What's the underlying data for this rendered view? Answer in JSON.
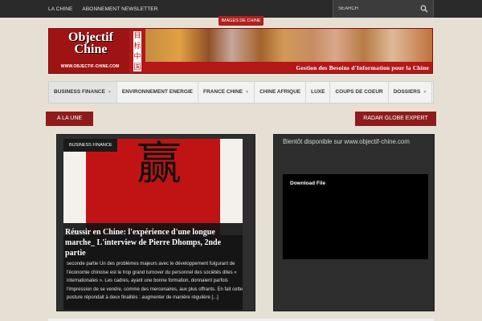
{
  "topbar": {
    "links": [
      "LA CHINE",
      "ABONNEMENT NEWSLETTER"
    ],
    "search_placeholder": "SEARCH"
  },
  "images_tab": "IMAGES DE CHINE",
  "banner": {
    "logo_line1": "Objectif",
    "logo_line2": "Chine",
    "logo_url": "WWW.OBJECTIF-CHINE.COM",
    "cn_chars": [
      "目",
      "标",
      "中",
      "国"
    ],
    "slogan": "Gestion des Besoins d'Information pour la Chine"
  },
  "nav": {
    "items": [
      {
        "label": "BUSINESS FINANCE",
        "has_dropdown": true
      },
      {
        "label": "ENVIRONNEMENT ENERGIE",
        "has_dropdown": false
      },
      {
        "label": "FRANCE CHINE",
        "has_dropdown": true
      },
      {
        "label": "CHINE AFRIQUE",
        "has_dropdown": false
      },
      {
        "label": "LUXE",
        "has_dropdown": false
      },
      {
        "label": "COUPS DE COEUR",
        "has_dropdown": false
      },
      {
        "label": "DOSSIERS",
        "has_dropdown": true
      }
    ]
  },
  "sections": {
    "left": "A LA UNE",
    "right": "RADAR GLOBE EXPERT"
  },
  "feature": {
    "category": "BUSINESS FINANCE",
    "glyph": "赢",
    "title": "Réussir en Chine: l'expérience d'une longue marche_ L'interview de Pierre Dhomps, 2nde partie",
    "excerpt": " seconde partie   Un des problèmes majeurs avec le développement fulgurant de l'économie chinoise est le trop grand turnover du personnel des sociétés dites « internationales ». Les cadres, ayant une bonne formation, donnaient parfois l'impression de se vendre, comme des mercenaires, aux plus offrants. En fait cette posture répondait à deux finalités : augmenter de manière régulière [...]"
  },
  "right_panel": {
    "title": "Bientôt disponible sur www.objectif-chine.com",
    "video_label": "Download File"
  },
  "colors": {
    "brand_red": "#b41818",
    "section_red": "#8e1c1c",
    "topbar": "#2a2a2a",
    "background": "#e6dfd3"
  }
}
